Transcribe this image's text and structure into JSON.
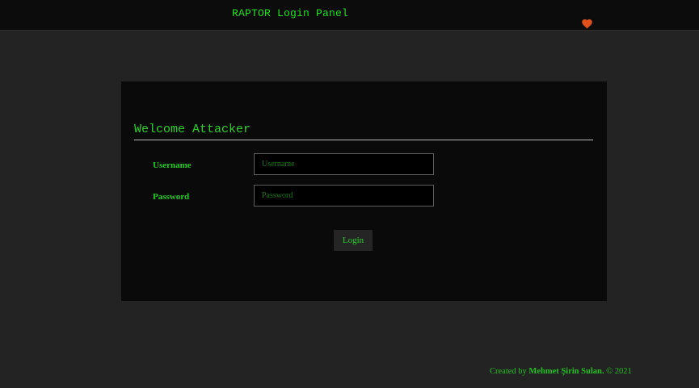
{
  "header": {
    "title": "RAPTOR Login Panel",
    "heart_icon": "heart-icon",
    "heart_color": "#e0501a"
  },
  "panel": {
    "welcome": "Welcome Attacker",
    "username_label": "Username",
    "username_placeholder": "Username",
    "username_value": "",
    "password_label": "Password",
    "password_placeholder": "Password",
    "password_value": "",
    "login_label": "Login"
  },
  "footer": {
    "prefix": "Created by ",
    "author": "Mehmet Şirin Sulan.",
    "suffix": " © 2021"
  },
  "colors": {
    "accent": "#22e022",
    "background": "#232323",
    "topbar": "#0c0c0c",
    "panel": "#0a0a0a"
  }
}
